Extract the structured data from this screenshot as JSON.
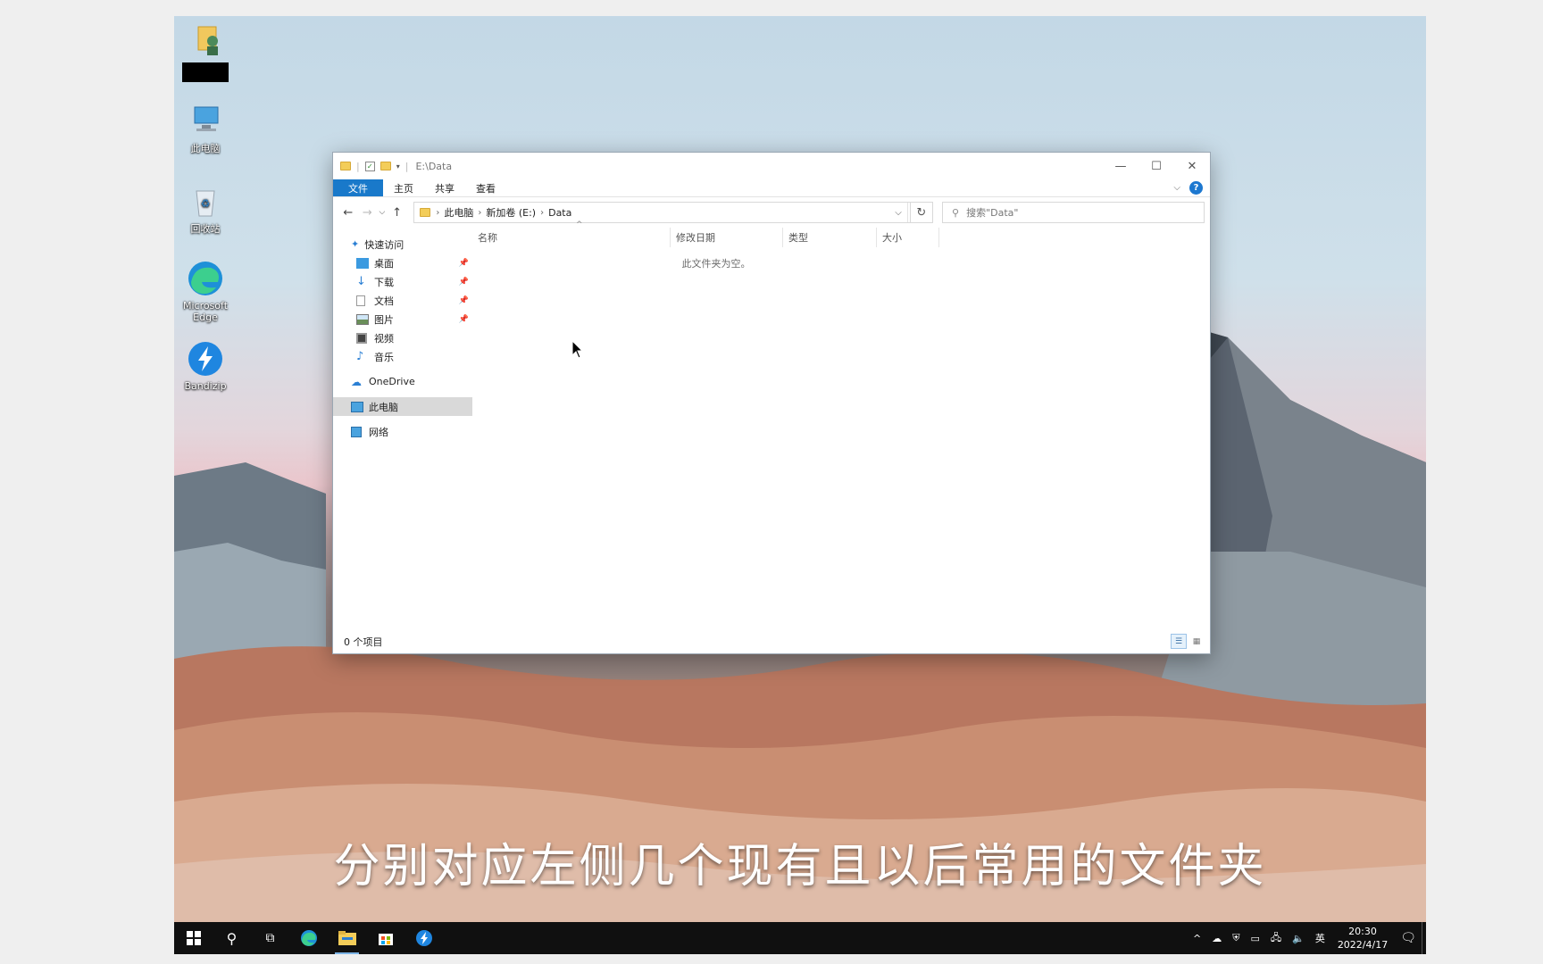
{
  "desktop": {
    "icons": [
      {
        "name": "user-folder-icon",
        "label": ""
      },
      {
        "name": "this-pc-icon",
        "label": "此电脑"
      },
      {
        "name": "recycle-bin-icon",
        "label": "回收站"
      },
      {
        "name": "edge-icon",
        "label": "Microsoft Edge"
      },
      {
        "name": "bandizip-icon",
        "label": "Bandizip"
      }
    ]
  },
  "window": {
    "title_path": "E:\\Data",
    "ribbon_tabs": [
      "文件",
      "主页",
      "共享",
      "查看"
    ],
    "breadcrumb": [
      "此电脑",
      "新加卷 (E:)",
      "Data"
    ],
    "search_placeholder": "搜索\"Data\"",
    "nav": {
      "quick_access": "快速访问",
      "items": [
        "桌面",
        "下载",
        "文档",
        "图片",
        "视频",
        "音乐"
      ],
      "onedrive": "OneDrive",
      "this_pc": "此电脑",
      "network": "网络"
    },
    "columns": [
      "名称",
      "修改日期",
      "类型",
      "大小"
    ],
    "empty_message": "此文件夹为空。",
    "status": "0 个项目"
  },
  "subtitle": "分别对应左侧几个现有且以后常用的文件夹",
  "taskbar": {
    "tray_lang": "英",
    "time": "20:30",
    "date": "2022/4/17"
  }
}
